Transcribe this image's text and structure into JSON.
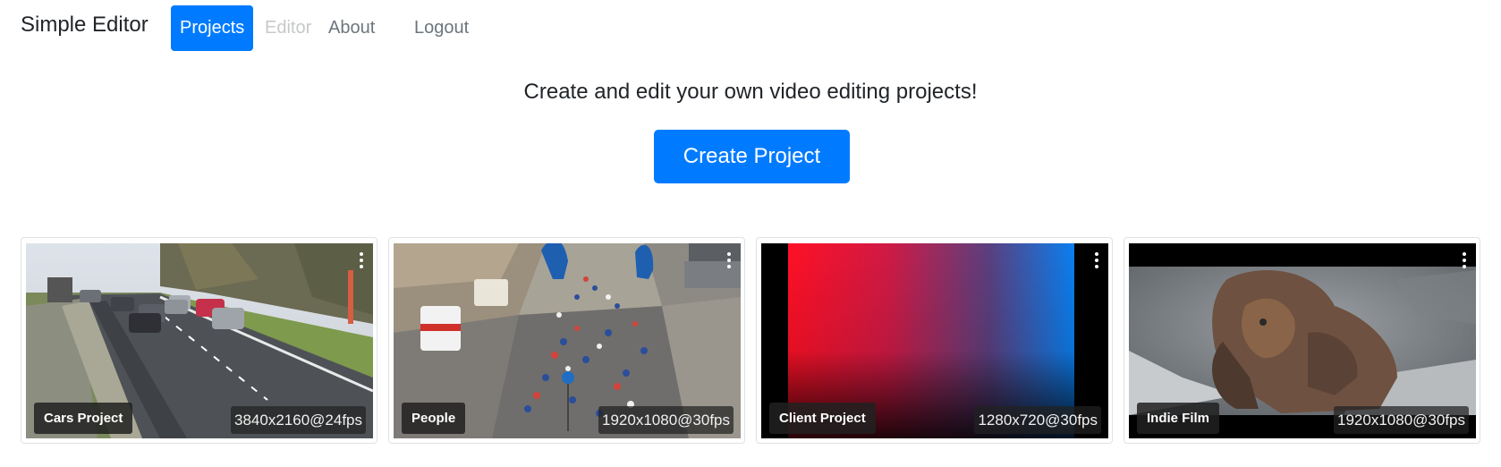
{
  "nav": {
    "brand": "Simple Editor",
    "links": [
      {
        "label": "Projects",
        "state": "active"
      },
      {
        "label": "Editor",
        "state": "disabled"
      },
      {
        "label": "About",
        "state": "normal"
      },
      {
        "label": "Logout",
        "state": "normal"
      }
    ]
  },
  "hero": {
    "tagline": "Create and edit your own video editing projects!",
    "create_label": "Create Project"
  },
  "projects": [
    {
      "name": "Cars Project",
      "resolution": "3840x2160@24fps",
      "thumbnail": "highway-cars"
    },
    {
      "name": "People",
      "resolution": "1920x1080@30fps",
      "thumbnail": "marathon-runners"
    },
    {
      "name": "Client Project",
      "resolution": "1280x720@30fps",
      "thumbnail": "red-blue-gradient"
    },
    {
      "name": "Indie Film",
      "resolution": "1920x1080@30fps",
      "thumbnail": "animated-creature-snow"
    }
  ],
  "colors": {
    "primary": "#007bff",
    "nav_muted": "#6c757d",
    "nav_disabled": "#c6c8ca",
    "tag_bg": "#212121"
  },
  "icons": {
    "card_menu": "more-vertical-icon"
  }
}
